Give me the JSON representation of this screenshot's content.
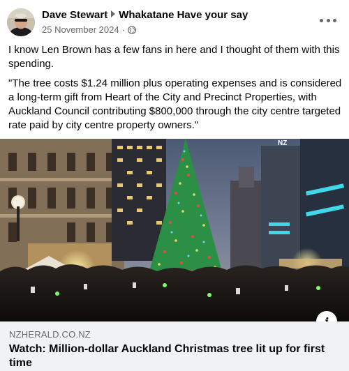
{
  "post": {
    "author": "Dave Stewart",
    "group": "Whakatane Have your say",
    "date": "25 November 2024",
    "separator": "·",
    "audience_icon": "globe-icon",
    "more_icon": "more-options-icon",
    "paragraphs": [
      "I know Len Brown has a few fans in here and I thought of them with this spending.",
      "\"The tree costs $1.24 million plus operating expenses and is considered a long-term gift from Heart of the City and Precinct Properties, with Auckland Council contributing $800,000 through the city centre targeted rate paid by city centre property owners.\""
    ]
  },
  "link": {
    "domain": "NZHERALD.CO.NZ",
    "title": "Watch: Million-dollar Auckland Christmas tree lit up for first time",
    "info_icon": "info-icon",
    "info_glyph": "i",
    "image_sign_text": "NZ"
  },
  "colors": {
    "text_primary": "#050505",
    "text_secondary": "#65676b",
    "preview_bg": "#f0f2f5"
  }
}
